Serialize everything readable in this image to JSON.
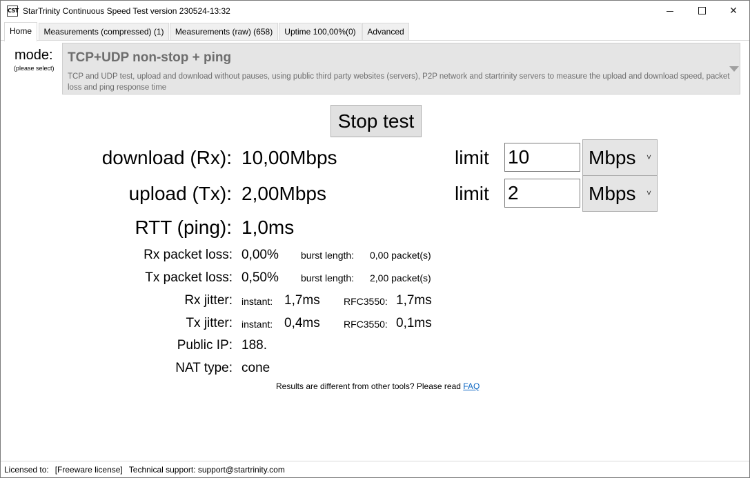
{
  "window": {
    "icon_text": "CST",
    "title": "StarTrinity Continuous Speed Test version 230524-13:32",
    "minimize": "",
    "maximize": "",
    "close": "✕"
  },
  "tabs": [
    {
      "label": "Home"
    },
    {
      "label": "Measurements (compressed)  (1)"
    },
    {
      "label": "Measurements (raw)  (658)"
    },
    {
      "label": "Uptime  100,00%(0)"
    },
    {
      "label": "Advanced"
    }
  ],
  "mode": {
    "label": "mode:",
    "sublabel": "(please select)",
    "selected_title": "TCP+UDP non-stop + ping",
    "selected_description": "TCP and UDP test, upload and download without pauses, using public third party websites (servers), P2P network and startrinity servers to measure the upload and download speed, packet loss and ping response time"
  },
  "stop_button": "Stop test",
  "metrics": {
    "download_label": "download (Rx):",
    "download_value": "10,00Mbps",
    "upload_label": "upload (Tx):",
    "upload_value": "2,00Mbps",
    "rtt_label": "RTT (ping):",
    "rtt_value": "1,0ms",
    "rx_loss_label": "Rx packet loss:",
    "rx_loss_value": "0,00%",
    "rx_burst_label": "burst length:",
    "rx_burst_value": "0,00 packet(s)",
    "tx_loss_label": "Tx packet loss:",
    "tx_loss_value": "0,50%",
    "tx_burst_label": "burst length:",
    "tx_burst_value": "2,00 packet(s)",
    "rx_jitter_label": "Rx jitter:",
    "rx_jitter_instant_label": "instant:",
    "rx_jitter_instant_value": "1,7ms",
    "rx_jitter_rfc_label": "RFC3550:",
    "rx_jitter_rfc_value": "1,7ms",
    "tx_jitter_label": "Tx jitter:",
    "tx_jitter_instant_label": "instant:",
    "tx_jitter_instant_value": "0,4ms",
    "tx_jitter_rfc_label": "RFC3550:",
    "tx_jitter_rfc_value": "0,1ms",
    "public_ip_label": "Public IP:",
    "public_ip_value": "188.",
    "nat_label": "NAT type:",
    "nat_value": "cone"
  },
  "limits": {
    "download_label": "limit",
    "download_value": "10",
    "download_unit": "Mbps",
    "upload_label": "limit",
    "upload_value": "2",
    "upload_unit": "Mbps",
    "chevron": "˅"
  },
  "faq": {
    "text": "Results are different from other tools? Please read ",
    "link": "FAQ"
  },
  "status": {
    "license_label": "Licensed to:",
    "license_value": "[Freeware license]",
    "support": "Technical support: support@startrinity.com"
  }
}
